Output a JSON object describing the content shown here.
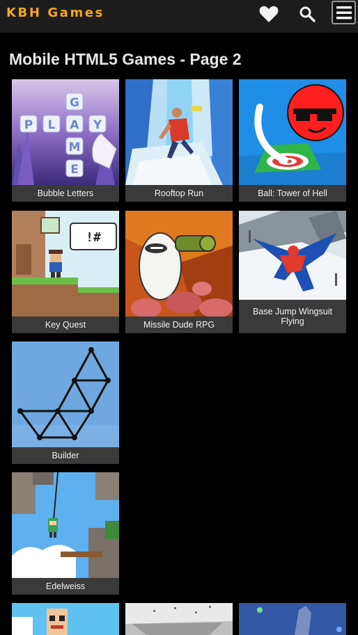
{
  "header": {
    "brand": "KBH Games",
    "icons": [
      "heart-icon",
      "search-icon",
      "menu-icon"
    ],
    "brand_color": "#f5a623",
    "bar_color": "#1c1c1c"
  },
  "page": {
    "title": "Mobile HTML5 Games - Page 2"
  },
  "games": [
    {
      "title": "Bubble Letters"
    },
    {
      "title": "Rooftop Run"
    },
    {
      "title": "Ball: Tower of Hell"
    },
    {
      "title": "Key Quest"
    },
    {
      "title": "Missile Dude RPG"
    },
    {
      "title": "Base Jump Wingsuit Flying"
    },
    {
      "title": "Builder"
    },
    {
      "title": "Edelweiss"
    }
  ],
  "thumb_text": {
    "bubble_letters_grid": [
      "G",
      "P",
      "L",
      "A",
      "Y",
      "M",
      "E"
    ],
    "key_quest_bubble": "!#"
  }
}
